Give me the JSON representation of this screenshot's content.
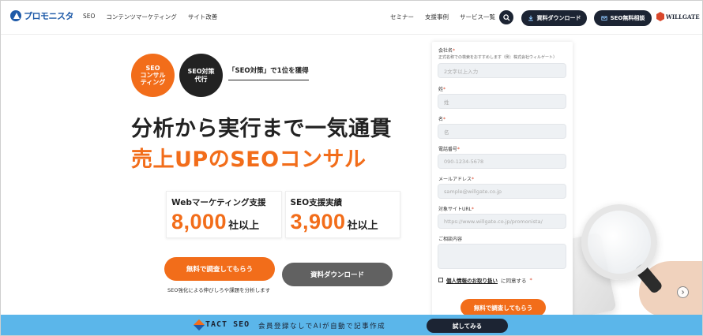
{
  "header": {
    "logo_text": "プロモニスタ",
    "nav_left": [
      "SEO",
      "コンテンツマーケティング",
      "サイト改善"
    ],
    "nav_right": [
      "セミナー",
      "支援事例",
      "サービス一覧"
    ],
    "download_label": "資料ダウンロード",
    "consult_label": "SEO無料相談",
    "partner_logo": "WILLGATE"
  },
  "hero": {
    "badge_orange": "SEO\nコンサル\nティング",
    "badge_dark": "SEO対策\n代行",
    "tagline": "「SEO対策」で1位を獲得",
    "headline1": "分析から実行まで一気通貫",
    "headline2": "売上UPのSEOコンサル",
    "stats": [
      {
        "label": "Webマーケティング支援",
        "value": "8,000",
        "unit": "社以上"
      },
      {
        "label": "SEO支援実績",
        "value": "3,900",
        "unit": "社以上"
      }
    ],
    "cta_primary": "無料で調査してもらう",
    "cta_secondary": "資料ダウンロード",
    "cta_note": "SEO強化による伸びしろや課題を分析します"
  },
  "form": {
    "company_label": "会社名",
    "company_hint": "正式名称での検索をおすすめします（例：株式会社ウィルゲート）",
    "company_placeholder": "2文字以上入力",
    "lastname_label": "姓",
    "lastname_placeholder": "姓",
    "firstname_label": "名",
    "firstname_placeholder": "名",
    "phone_label": "電話番号",
    "phone_placeholder": "090-1234-5678",
    "email_label": "メールアドレス",
    "email_placeholder": "sample@willgate.co.jp",
    "url_label": "対象サイトURL",
    "url_placeholder": "https://www.willgate.co.jp/promonista/",
    "inquiry_label": "ご相談内容",
    "required_mark": "*",
    "consent_link": "個人情報のお取り扱い",
    "consent_suffix": "に同意する",
    "submit_label": "無料で調査してもらう"
  },
  "banner": {
    "logo_text": "TACT SEO",
    "text": "会員登録なしでAIが自動で記事作成",
    "button_label": "試してみる"
  },
  "colors": {
    "accent": "#f26d1a",
    "dark": "#1c2433",
    "banner": "#5bb6ea"
  }
}
